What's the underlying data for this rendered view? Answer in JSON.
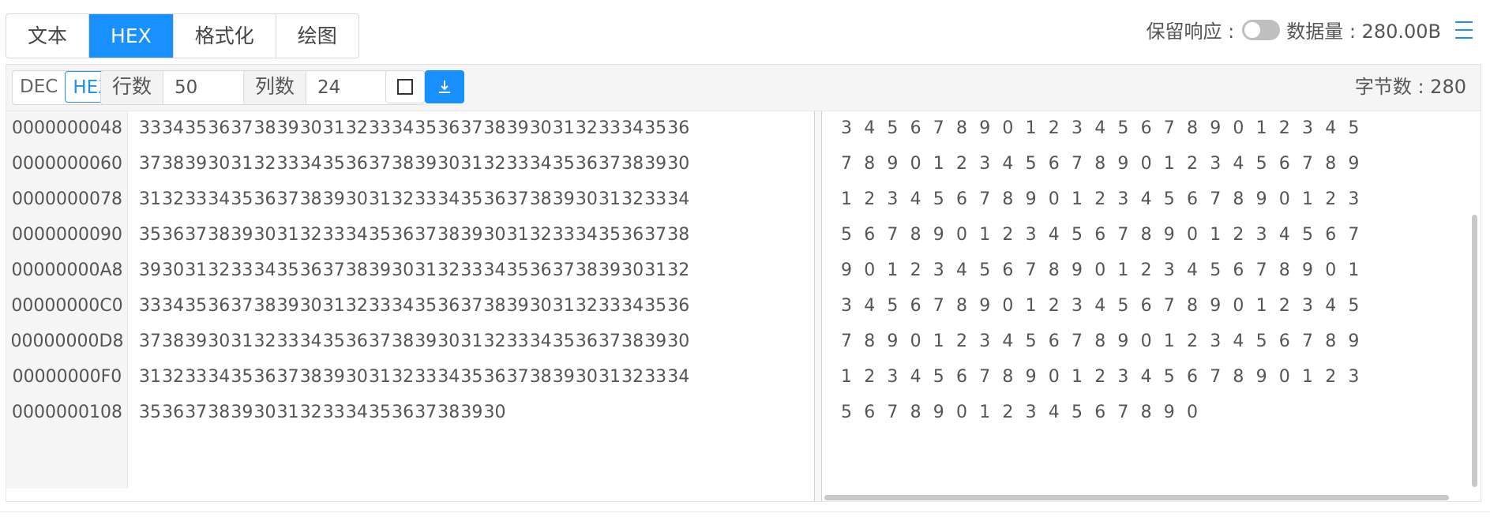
{
  "tabs": [
    {
      "label": "文本",
      "active": false
    },
    {
      "label": "HEX",
      "active": true
    },
    {
      "label": "格式化",
      "active": false
    },
    {
      "label": "绘图",
      "active": false
    }
  ],
  "header": {
    "keep_response_label": "保留响应 :",
    "keep_response_on": false,
    "data_size_label": "数据量 : 280.00B",
    "menu_icon": "menu-icon"
  },
  "toolbar": {
    "format_options": [
      {
        "label": "DEC",
        "active": false
      },
      {
        "label": "HEX",
        "active": true
      }
    ],
    "rows_label": "行数",
    "rows_value": "50",
    "cols_label": "列数",
    "cols_value": "24",
    "checkbox_icon": "square-icon",
    "download_icon": "download-icon",
    "byte_count_label": "字节数 : 280"
  },
  "colors": {
    "accent": "#1890ff",
    "address_bg": "#f5f5f5",
    "toggle_off": "#bfbfbf"
  },
  "rows": [
    {
      "addr": "0000000048",
      "hex": [
        "33",
        "34",
        "35",
        "36",
        "37",
        "38",
        "39",
        "30",
        "31",
        "32",
        "33",
        "34",
        "35",
        "36",
        "37",
        "38",
        "39",
        "30",
        "31",
        "32",
        "33",
        "34",
        "35",
        "36"
      ],
      "text": [
        "3",
        "4",
        "5",
        "6",
        "7",
        "8",
        "9",
        "0",
        "1",
        "2",
        "3",
        "4",
        "5",
        "6",
        "7",
        "8",
        "9",
        "0",
        "1",
        "2",
        "3",
        "4",
        "5"
      ]
    },
    {
      "addr": "0000000060",
      "hex": [
        "37",
        "38",
        "39",
        "30",
        "31",
        "32",
        "33",
        "34",
        "35",
        "36",
        "37",
        "38",
        "39",
        "30",
        "31",
        "32",
        "33",
        "34",
        "35",
        "36",
        "37",
        "38",
        "39",
        "30"
      ],
      "text": [
        "7",
        "8",
        "9",
        "0",
        "1",
        "2",
        "3",
        "4",
        "5",
        "6",
        "7",
        "8",
        "9",
        "0",
        "1",
        "2",
        "3",
        "4",
        "5",
        "6",
        "7",
        "8",
        "9"
      ]
    },
    {
      "addr": "0000000078",
      "hex": [
        "31",
        "32",
        "33",
        "34",
        "35",
        "36",
        "37",
        "38",
        "39",
        "30",
        "31",
        "32",
        "33",
        "34",
        "35",
        "36",
        "37",
        "38",
        "39",
        "30",
        "31",
        "32",
        "33",
        "34"
      ],
      "text": [
        "1",
        "2",
        "3",
        "4",
        "5",
        "6",
        "7",
        "8",
        "9",
        "0",
        "1",
        "2",
        "3",
        "4",
        "5",
        "6",
        "7",
        "8",
        "9",
        "0",
        "1",
        "2",
        "3"
      ]
    },
    {
      "addr": "0000000090",
      "hex": [
        "35",
        "36",
        "37",
        "38",
        "39",
        "30",
        "31",
        "32",
        "33",
        "34",
        "35",
        "36",
        "37",
        "38",
        "39",
        "30",
        "31",
        "32",
        "33",
        "34",
        "35",
        "36",
        "37",
        "38"
      ],
      "text": [
        "5",
        "6",
        "7",
        "8",
        "9",
        "0",
        "1",
        "2",
        "3",
        "4",
        "5",
        "6",
        "7",
        "8",
        "9",
        "0",
        "1",
        "2",
        "3",
        "4",
        "5",
        "6",
        "7"
      ]
    },
    {
      "addr": "00000000A8",
      "hex": [
        "39",
        "30",
        "31",
        "32",
        "33",
        "34",
        "35",
        "36",
        "37",
        "38",
        "39",
        "30",
        "31",
        "32",
        "33",
        "34",
        "35",
        "36",
        "37",
        "38",
        "39",
        "30",
        "31",
        "32"
      ],
      "text": [
        "9",
        "0",
        "1",
        "2",
        "3",
        "4",
        "5",
        "6",
        "7",
        "8",
        "9",
        "0",
        "1",
        "2",
        "3",
        "4",
        "5",
        "6",
        "7",
        "8",
        "9",
        "0",
        "1"
      ]
    },
    {
      "addr": "00000000C0",
      "hex": [
        "33",
        "34",
        "35",
        "36",
        "37",
        "38",
        "39",
        "30",
        "31",
        "32",
        "33",
        "34",
        "35",
        "36",
        "37",
        "38",
        "39",
        "30",
        "31",
        "32",
        "33",
        "34",
        "35",
        "36"
      ],
      "text": [
        "3",
        "4",
        "5",
        "6",
        "7",
        "8",
        "9",
        "0",
        "1",
        "2",
        "3",
        "4",
        "5",
        "6",
        "7",
        "8",
        "9",
        "0",
        "1",
        "2",
        "3",
        "4",
        "5"
      ]
    },
    {
      "addr": "00000000D8",
      "hex": [
        "37",
        "38",
        "39",
        "30",
        "31",
        "32",
        "33",
        "34",
        "35",
        "36",
        "37",
        "38",
        "39",
        "30",
        "31",
        "32",
        "33",
        "34",
        "35",
        "36",
        "37",
        "38",
        "39",
        "30"
      ],
      "text": [
        "7",
        "8",
        "9",
        "0",
        "1",
        "2",
        "3",
        "4",
        "5",
        "6",
        "7",
        "8",
        "9",
        "0",
        "1",
        "2",
        "3",
        "4",
        "5",
        "6",
        "7",
        "8",
        "9"
      ]
    },
    {
      "addr": "00000000F0",
      "hex": [
        "31",
        "32",
        "33",
        "34",
        "35",
        "36",
        "37",
        "38",
        "39",
        "30",
        "31",
        "32",
        "33",
        "34",
        "35",
        "36",
        "37",
        "38",
        "39",
        "30",
        "31",
        "32",
        "33",
        "34"
      ],
      "text": [
        "1",
        "2",
        "3",
        "4",
        "5",
        "6",
        "7",
        "8",
        "9",
        "0",
        "1",
        "2",
        "3",
        "4",
        "5",
        "6",
        "7",
        "8",
        "9",
        "0",
        "1",
        "2",
        "3"
      ]
    },
    {
      "addr": "0000000108",
      "hex": [
        "35",
        "36",
        "37",
        "38",
        "39",
        "30",
        "31",
        "32",
        "33",
        "34",
        "35",
        "36",
        "37",
        "38",
        "39",
        "30"
      ],
      "text": [
        "5",
        "6",
        "7",
        "8",
        "9",
        "0",
        "1",
        "2",
        "3",
        "4",
        "5",
        "6",
        "7",
        "8",
        "9",
        "0"
      ]
    }
  ]
}
